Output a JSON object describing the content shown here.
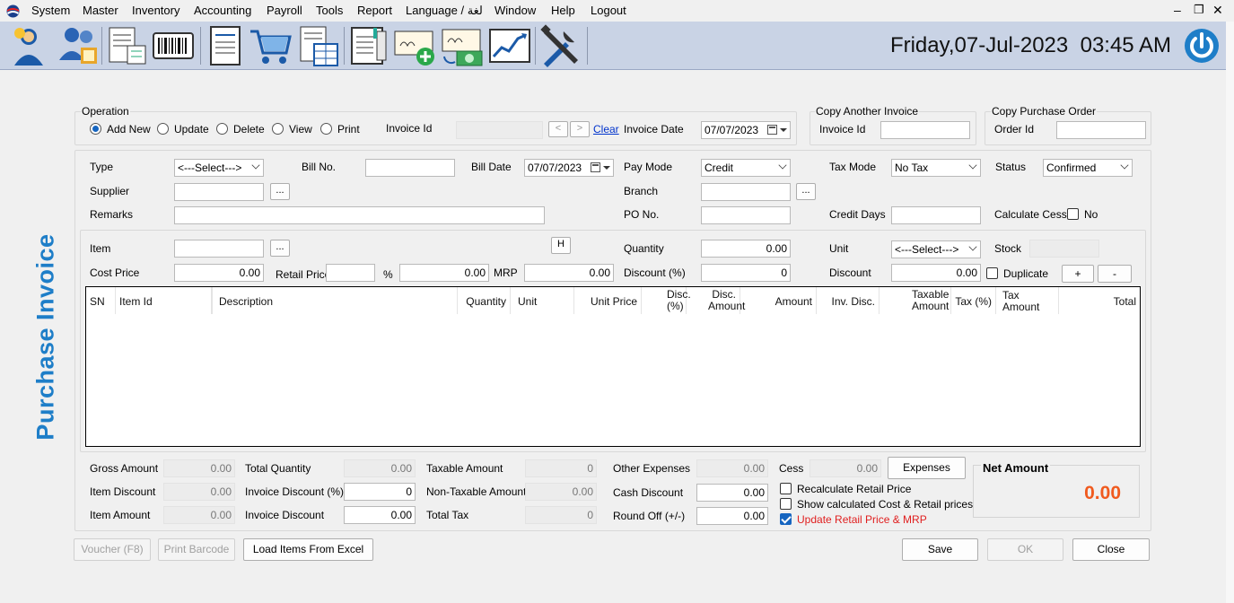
{
  "menu": {
    "items": [
      "System",
      "Master",
      "Inventory",
      "Accounting",
      "Payroll",
      "Tools",
      "Report",
      "Language / لغة",
      "Window",
      "Help",
      "Logout"
    ]
  },
  "window_controls": {
    "minimize": "–",
    "restore": "❐",
    "close": "✕"
  },
  "toolbar": {
    "icons": [
      "users-icon",
      "employee-icon",
      "report-list-icon",
      "barcode-icon",
      "document-icon",
      "shopping-cart-icon",
      "invoice-table-icon",
      "ledger-icon",
      "cheque-add-icon",
      "cheque-payment-icon",
      "chart-icon",
      "tools-icon"
    ]
  },
  "clock": {
    "text": "Friday,07-Jul-2023  03:45 AM"
  },
  "page_title": "Purchase Invoice",
  "operation": {
    "legend": "Operation",
    "options": [
      "Add New",
      "Update",
      "Delete",
      "View",
      "Print"
    ],
    "selected": "Add New",
    "invoice_id_label": "Invoice Id",
    "invoice_id_value": "",
    "prev": "<",
    "next": ">",
    "clear": "Clear",
    "invoice_date_label": "Invoice Date",
    "invoice_date": "07/07/2023"
  },
  "copy_invoice": {
    "legend": "Copy Another Invoice",
    "label": "Invoice Id",
    "value": ""
  },
  "copy_po": {
    "legend": "Copy Purchase Order",
    "label": "Order Id",
    "value": ""
  },
  "header": {
    "type_label": "Type",
    "type_value": "<---Select--->",
    "bill_no_label": "Bill No.",
    "bill_no": "",
    "bill_date_label": "Bill Date",
    "bill_date": "07/07/2023",
    "pay_mode_label": "Pay Mode",
    "pay_mode": "Credit",
    "tax_mode_label": "Tax Mode",
    "tax_mode": "No Tax",
    "status_label": "Status",
    "status": "Confirmed",
    "supplier_label": "Supplier",
    "supplier": "",
    "branch_label": "Branch",
    "branch": "",
    "remarks_label": "Remarks",
    "remarks": "",
    "po_no_label": "PO No.",
    "po_no": "",
    "credit_days_label": "Credit Days",
    "credit_days": "",
    "calc_cess_label": "Calculate Cess",
    "calc_cess_check": "No",
    "browse": "..."
  },
  "item_entry": {
    "item_label": "Item",
    "item": "",
    "h_button": "H",
    "quantity_label": "Quantity",
    "quantity": "0.00",
    "unit_label": "Unit",
    "unit": "<---Select--->",
    "stock_label": "Stock",
    "stock": "",
    "cost_price_label": "Cost Price",
    "cost_price": "0.00",
    "retail_price_label": "Retail Price",
    "retail_price": "",
    "pct": "%",
    "pct_value": "0.00",
    "mrp_label": "MRP",
    "mrp": "0.00",
    "discount_pct_label": "Discount (%)",
    "discount_pct": "0",
    "discount_label": "Discount",
    "discount": "0.00",
    "duplicate_label": "Duplicate",
    "plus": "+",
    "minus": "-"
  },
  "grid": {
    "columns": [
      "SN",
      "Item Id",
      "Description",
      "Quantity",
      "Unit",
      "Unit Price",
      "Disc. (%)",
      "Disc. Amount",
      "Amount",
      "Inv. Disc.",
      "Taxable Amount",
      "Tax (%)",
      "Tax Amount",
      "Total"
    ],
    "rows": []
  },
  "totals": {
    "gross_amount_label": "Gross Amount",
    "gross_amount": "0.00",
    "item_discount_label": "Item Discount",
    "item_discount": "0.00",
    "item_amount_label": "Item Amount",
    "item_amount": "0.00",
    "total_quantity_label": "Total Quantity",
    "total_quantity": "0.00",
    "invoice_discount_pct_label": "Invoice Discount (%)",
    "invoice_discount_pct": "0",
    "invoice_discount_label": "Invoice Discount",
    "invoice_discount": "0.00",
    "taxable_amount_label": "Taxable Amount",
    "taxable_amount": "0",
    "non_taxable_amount_label": "Non-Taxable Amount",
    "non_taxable_amount": "0.00",
    "total_tax_label": "Total Tax",
    "total_tax": "0",
    "other_expenses_label": "Other Expenses",
    "other_expenses": "0.00",
    "cash_discount_label": "Cash Discount",
    "cash_discount": "0.00",
    "round_off_label": "Round Off (+/-)",
    "round_off": "0.00",
    "cess_label": "Cess",
    "cess": "0.00",
    "expenses_button": "Expenses",
    "recalc_label": "Recalculate Retail Price",
    "show_calc_label": "Show calculated Cost & Retail prices",
    "update_retail_label": "Update Retail Price & MRP",
    "net_amount_label": "Net Amount",
    "net_amount": "0.00"
  },
  "footer": {
    "voucher": "Voucher (F8)",
    "print_barcode": "Print Barcode",
    "load_excel": "Load Items From Excel",
    "save": "Save",
    "ok": "OK",
    "close": "Close"
  },
  "colors": {
    "accent": "#1e7ec8",
    "net_amount": "#f05a1e",
    "update_label": "#e01e1e",
    "toolbar_bg": "#c9d3e5"
  }
}
